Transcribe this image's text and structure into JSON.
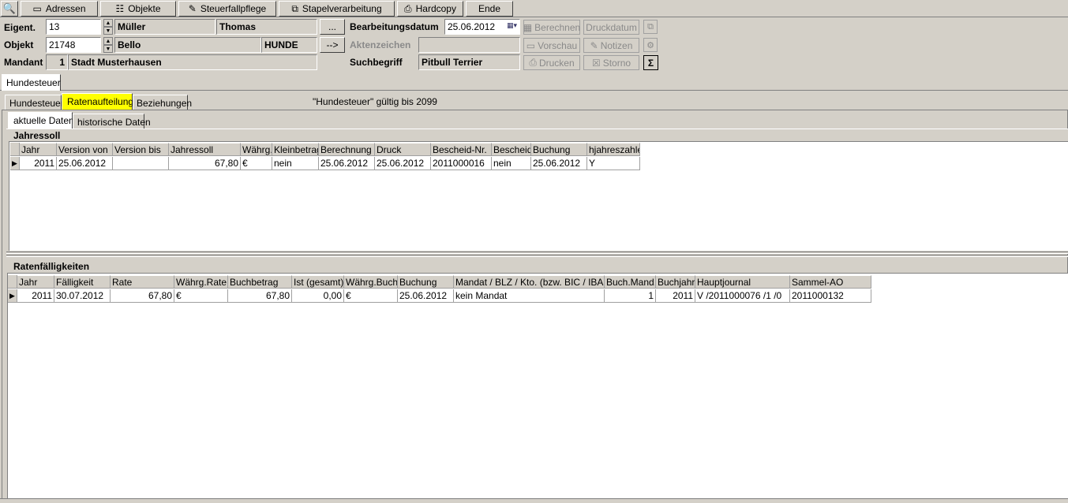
{
  "toolbar": {
    "zoom_icon": "magnifier-icon",
    "buttons": [
      {
        "label": "Adressen",
        "icon": "address-card-icon"
      },
      {
        "label": "Objekte",
        "icon": "tree-icon"
      },
      {
        "label": "Steuerfallpflege",
        "icon": "edit-doc-icon"
      },
      {
        "label": "Stapelverarbeitung",
        "icon": "stack-icon"
      },
      {
        "label": "Hardcopy",
        "icon": "printer-icon"
      },
      {
        "label": "Ende",
        "icon": ""
      }
    ]
  },
  "header": {
    "eigent_label": "Eigent.",
    "eigent_value": "13",
    "eigent_lastname": "Müller",
    "eigent_firstname": "Thomas",
    "objekt_label": "Objekt",
    "objekt_value": "21748",
    "objekt_name": "Bello",
    "objekt_type": "HUNDE",
    "mandant_label": "Mandant",
    "mandant_value": "1",
    "mandant_name": "Stadt Musterhausen",
    "dots_button": "...",
    "arrow_button": "-->",
    "bearbeitungsdatum_label": "Bearbeitungsdatum",
    "bearbeitungsdatum_value": "25.06.2012",
    "aktenzeichen_label": "Aktenzeichen",
    "aktenzeichen_value": "",
    "suchbegriff_label": "Suchbegriff",
    "suchbegriff_value": "Pitbull Terrier",
    "berechnen": "Berechnen",
    "druckdatum": "Druckdatum",
    "vorschau": "Vorschau",
    "notizen": "Notizen",
    "drucken": "Drucken",
    "storno": "Storno",
    "sum_button": "Σ"
  },
  "main_tab": "Hundesteuer",
  "sub_tabs": [
    "Hundesteuer",
    "Ratenaufteilung",
    "Beziehungen"
  ],
  "validity_note": "\"Hundesteuer\" gültig bis 2099",
  "data_tabs": [
    "aktuelle Daten",
    "historische Daten"
  ],
  "jahressoll": {
    "title": "Jahressoll",
    "columns": [
      "Jahr",
      "Version von",
      "Version bis",
      "Jahressoll",
      "Währg.",
      "Kleinbetrag",
      "Berechnung",
      "Druck",
      "Bescheid-Nr.",
      "Bescheid",
      "Buchung",
      "hjahreszahler"
    ],
    "rows": [
      [
        "2011",
        "25.06.2012",
        "",
        "67,80",
        "€",
        "nein",
        "25.06.2012",
        "25.06.2012",
        "2011000016",
        "nein",
        "25.06.2012",
        "Y"
      ]
    ]
  },
  "ratenfaelligkeiten": {
    "title": "Ratenfälligkeiten",
    "columns": [
      "Jahr",
      "Fälligkeit",
      "Rate",
      "Währg.Rate",
      "Buchbetrag",
      "Ist (gesamt)",
      "Währg.Buch.",
      "Buchung",
      "Mandat / BLZ / Kto. (bzw. BIC / IBAN)",
      "Buch.Mand.",
      "Buchjahr",
      "Hauptjournal",
      "Sammel-AO"
    ],
    "rows": [
      [
        "2011",
        "30.07.2012",
        "67,80",
        "€",
        "67,80",
        "0,00",
        "€",
        "25.06.2012",
        "kein Mandat",
        "1",
        "2011",
        "V /2011000076 /1 /0",
        "2011000132"
      ]
    ]
  }
}
